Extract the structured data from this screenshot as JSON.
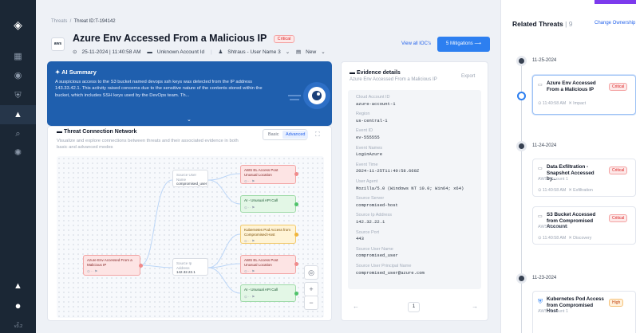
{
  "breadcrumb": {
    "root": "Threats",
    "current": "Threat ID:T-194142"
  },
  "threat": {
    "logo_text": "aws",
    "title": "Azure Env Accessed From a Malicious IP",
    "severity": "Critical",
    "datetime": "25-11-2024 | 11:40:58 AM",
    "account": "Unknown Account Id",
    "assignee": "Shtraus - User Name 3",
    "status": "New"
  },
  "actions": {
    "view_iocs": "View all IOC's",
    "mitigations": "5 Mitigations"
  },
  "ai_summary": {
    "title": "AI Summary",
    "text": "A suspicious access to the S3 bucket named devops ssh keys was detected from the IP address 143.33.42.1. This activity raised concerns due to the sensitive nature of the contents stored within the bucket, which includes SSH keys used by the DevOps team. Th..."
  },
  "network": {
    "title": "Threat Connection Network",
    "description": "Visualize and explore connections between threats and their associated evidence in both basic and advanced modes",
    "mode_basic": "Basic",
    "mode_advanced": "Advanced",
    "nodes": {
      "main_threat": "Azure Env Accessed From a Malicious IP",
      "user_name_label": "Source User Name",
      "user_name": "compromised_user",
      "ip_label": "Source Ip Address",
      "ip": "142.32.22.1",
      "aws_unusual_1": "AWS EL Access Post Unusual Location",
      "unusual_api_1": "AI - Unusual API Call",
      "k8s_pod": "Kubernetes Pod Access from Compromised Host",
      "aws_unusual_2": "AWS EL Access Post Unusual Location",
      "unusual_api_2": "AI - Unusual API Call"
    }
  },
  "evidence": {
    "title": "Evidence details",
    "subtitle": "Azure Env Accessed From a Malicious IP",
    "export": "Export",
    "items": [
      {
        "k": "Cloud Account ID",
        "v": "azure-account-1"
      },
      {
        "k": "Region",
        "v": "us-central-1"
      },
      {
        "k": "Event ID",
        "v": "ev-555555"
      },
      {
        "k": "Event Names",
        "v": "LoginAzure"
      },
      {
        "k": "Event Time",
        "v": "2024-11-25T11:40:58.669Z"
      },
      {
        "k": "User Agent",
        "v": "Mozilla/5.0 (Windows NT 10.0; Win64; x64)"
      },
      {
        "k": "Source Server",
        "v": "compromised-host"
      },
      {
        "k": "Source Ip Address",
        "v": "142.32.22.1"
      },
      {
        "k": "Source Port",
        "v": "443"
      },
      {
        "k": "Source User Name",
        "v": "compromised_user"
      },
      {
        "k": "Source User Principal Name",
        "v": "compromised_user@azure.com"
      }
    ],
    "page": "1"
  },
  "related": {
    "title": "Related Threats",
    "count": "9",
    "change_ownership": "Change Ownership",
    "groups": [
      {
        "date": "11-25-2024"
      },
      {
        "date": "11-24-2024"
      },
      {
        "date": "11-23-2024"
      }
    ],
    "cards": [
      {
        "title": "Azure Env Accessed From a Malicious IP",
        "severity": "Critical",
        "account": "",
        "time": "11:40:58 AM",
        "tag": "Impact"
      },
      {
        "title": "Data Exfiltration - Snapshot Accessed by...",
        "severity": "Critical",
        "account": "AWS Account 1",
        "time": "11:40:58 AM",
        "tag": "Exfiltration"
      },
      {
        "title": "S3 Bucket Accessed from Compromised Account",
        "severity": "Critical",
        "account": "AWS Account 1",
        "time": "11:40:58 AM",
        "tag": "Discovery"
      },
      {
        "title": "Kubernetes Pod Access from Compromised Host",
        "severity": "High",
        "account": "AWS Account 1",
        "time": "",
        "tag": ""
      }
    ]
  },
  "sidebar": {
    "version": "v3.2"
  }
}
